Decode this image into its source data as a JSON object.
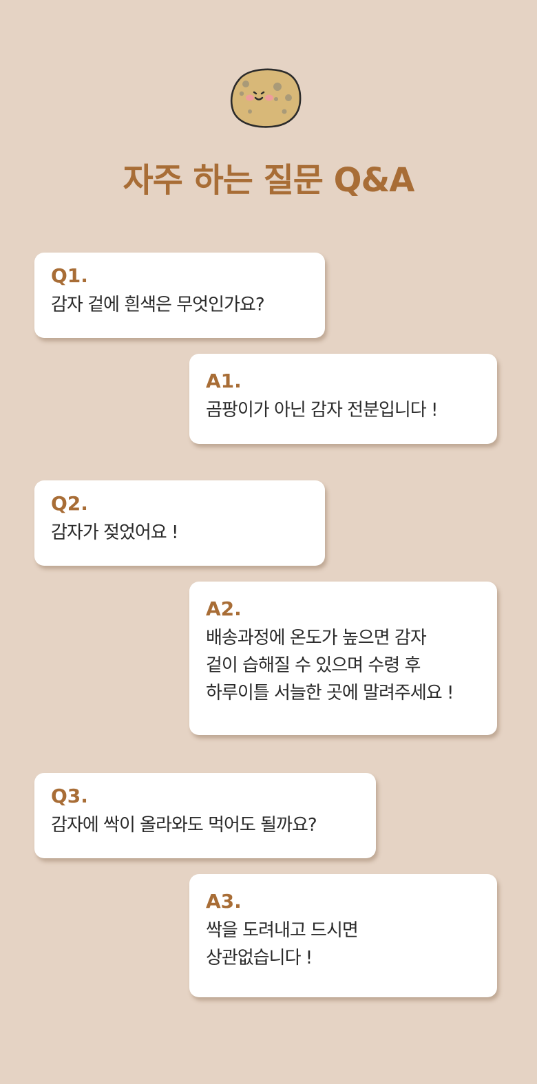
{
  "title": "자주 하는 질문 Q&A",
  "colors": {
    "background": "#e5d3c4",
    "accent": "#a86d36",
    "card": "#ffffff",
    "text": "#2a2a2a"
  },
  "mascot_icon": "potato-mascot-icon",
  "faq": [
    {
      "q_label": "Q1.",
      "q_text": "감자 겉에 흰색은 무엇인가요?",
      "a_label": "A1.",
      "a_text": "곰팡이가 아닌 감자 전분입니다 !"
    },
    {
      "q_label": "Q2.",
      "q_text": "감자가 젖었어요 !",
      "a_label": "A2.",
      "a_text": "배송과정에 온도가 높으면 감자\n겉이 습해질 수 있으며 수령 후\n하루이틀 서늘한 곳에 말려주세요 !"
    },
    {
      "q_label": "Q3.",
      "q_text": "감자에 싹이 올라와도 먹어도 될까요?",
      "a_label": "A3.",
      "a_text": "싹을 도려내고 드시면\n상관없습니다 !"
    }
  ]
}
